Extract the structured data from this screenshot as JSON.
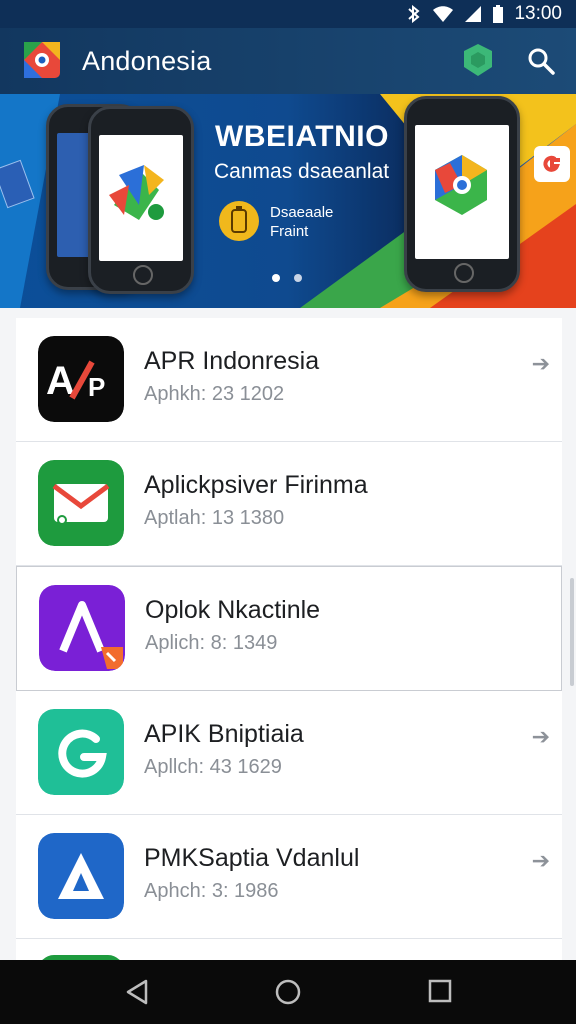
{
  "status": {
    "time": "13:00"
  },
  "app": {
    "title": "Andonesia"
  },
  "banner": {
    "title": "WBEIATNIO",
    "subtitle": "Canmas dsaeanlat",
    "badge_text_line1": "Dsaeaale",
    "badge_text_line2": "Fraint",
    "slides": 2,
    "active_slide": 1
  },
  "apps": [
    {
      "name": "APR Indonresia",
      "meta": "Aphkh: 23 1202",
      "icon": "apr-logo-icon",
      "color": "#0b0b0b",
      "chevron": true
    },
    {
      "name": "Aplickpsiver Firinma",
      "meta": "Aptlah: 13 1380",
      "icon": "mail-icon",
      "color": "#1e9b3e",
      "chevron": false
    },
    {
      "name": "Oplok Nkactinle",
      "meta": "Aplich: 8: 1349",
      "icon": "a-logo-icon",
      "color": "#7a20d6",
      "chevron": false
    },
    {
      "name": "APIK Bniptiaia",
      "meta": "Apllch: 43 1629",
      "icon": "g-logo-icon",
      "color": "#1fbf97",
      "chevron": true
    },
    {
      "name": "PMKSaptia Vdanlul",
      "meta": "Aphch: 3: 1986",
      "icon": "a-triangle-icon",
      "color": "#1f67c8",
      "chevron": true
    }
  ],
  "nav": {
    "back": "back-icon",
    "home": "home-icon",
    "recents": "recents-icon"
  }
}
